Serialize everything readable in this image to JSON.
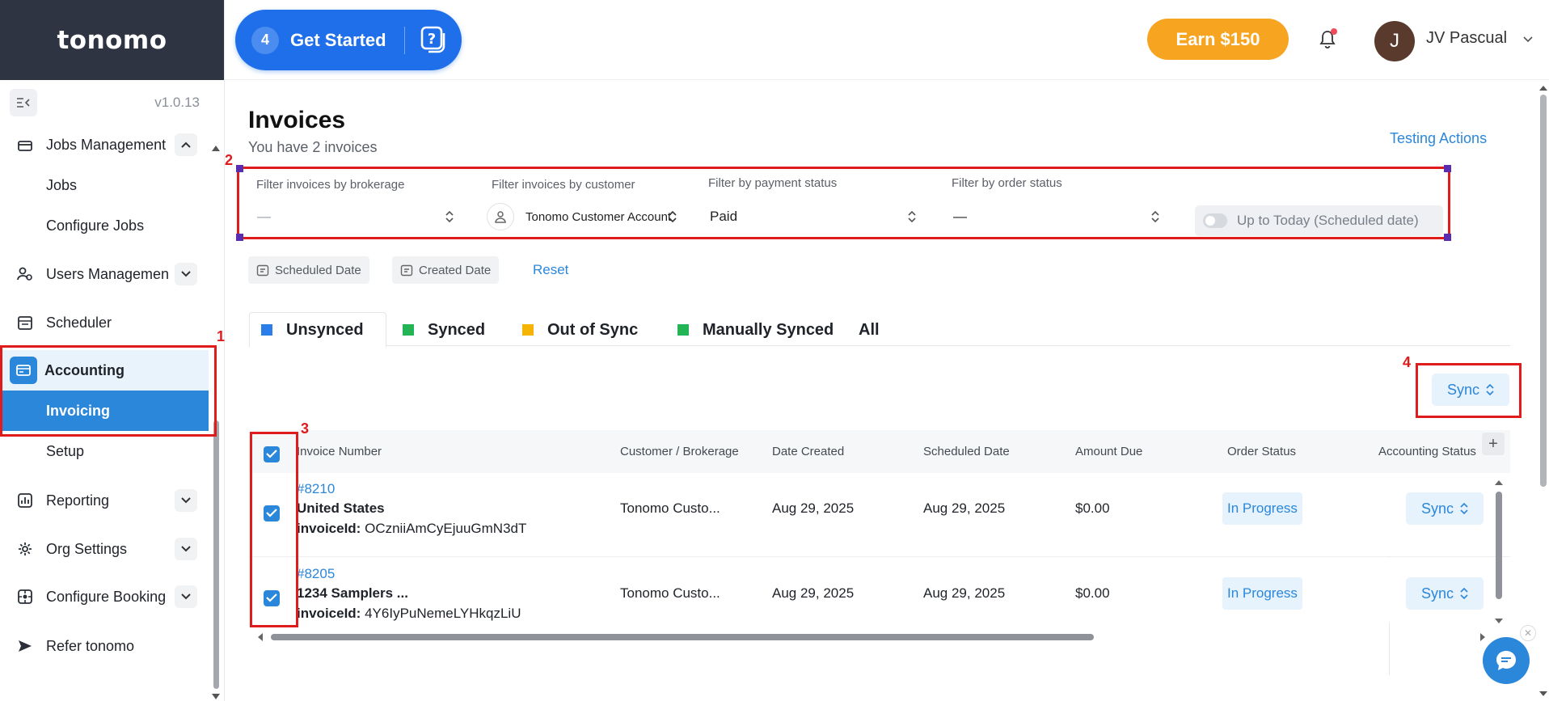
{
  "sidebar": {
    "brand": "tonomo",
    "version": "v1.0.13",
    "items": [
      {
        "label": "Jobs Management"
      },
      {
        "label": "Jobs"
      },
      {
        "label": "Configure Jobs"
      },
      {
        "label": "Users Managemen"
      },
      {
        "label": "Scheduler"
      },
      {
        "label": "Accounting"
      },
      {
        "label": "Invoicing"
      },
      {
        "label": "Setup"
      },
      {
        "label": "Reporting"
      },
      {
        "label": "Org Settings"
      },
      {
        "label": "Configure Booking"
      },
      {
        "label": "Refer tonomo"
      }
    ]
  },
  "header": {
    "get_started_count": "4",
    "get_started_label": "Get Started",
    "earn_label": "Earn $150",
    "avatar_initial": "J",
    "user_name": "JV Pascual"
  },
  "page": {
    "title": "Invoices",
    "subtitle": "You have 2 invoices",
    "testing_actions": "Testing Actions"
  },
  "filters": {
    "brokerage_label": "Filter invoices by brokerage",
    "brokerage_value": "—",
    "customer_label": "Filter invoices by customer",
    "customer_value": "Tonomo Customer Account",
    "payment_label": "Filter by payment status",
    "payment_value": "Paid",
    "order_label": "Filter by order status",
    "order_value": "—",
    "toggle_label": "Up to Today (Scheduled date)",
    "chip_scheduled": "Scheduled Date",
    "chip_created": "Created Date",
    "reset": "Reset"
  },
  "tabs": [
    {
      "label": "Unsynced",
      "color": "#2b7de9"
    },
    {
      "label": "Synced",
      "color": "#22b455"
    },
    {
      "label": "Out of Sync",
      "color": "#f4b400"
    },
    {
      "label": "Manually Synced",
      "color": "#22b455"
    },
    {
      "label": "All"
    }
  ],
  "sync_button": "Sync",
  "table": {
    "columns": [
      "Invoice Number",
      "Customer / Brokerage",
      "Date Created",
      "Scheduled Date",
      "Amount Due",
      "Order Status",
      "Accounting Status"
    ],
    "rows": [
      {
        "number": "#8210",
        "title": "United States",
        "invoice_id_label": "invoiceId:",
        "invoice_id": "OCzniiAmCyEjuuGmN3dT",
        "customer": "Tonomo Custo...",
        "created": "Aug 29, 2025",
        "scheduled": "Aug 29, 2025",
        "amount": "$0.00",
        "order_status": "In Progress",
        "accounting": "Sync"
      },
      {
        "number": "#8205",
        "title": "1234 Samplers ...",
        "invoice_id_label": "invoiceId:",
        "invoice_id": "4Y6IyPuNemeLYHkqzLiU",
        "customer": "Tonomo Custo...",
        "created": "Aug 29, 2025",
        "scheduled": "Aug 29, 2025",
        "amount": "$0.00",
        "order_status": "In Progress",
        "accounting": "Sync"
      }
    ]
  },
  "annotations": [
    "1",
    "2",
    "3",
    "4"
  ],
  "colors": {
    "primary": "#2b87da",
    "accent_orange": "#f7a520",
    "sidebar_header": "#2e3441",
    "annotation_red": "#e01b1b"
  }
}
